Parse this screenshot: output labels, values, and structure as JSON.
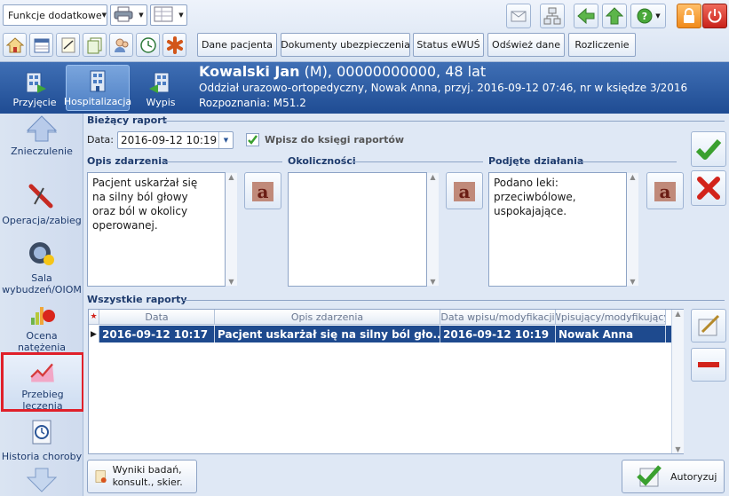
{
  "toolbar": {
    "functions_combo": "Funkcje dodatkowe",
    "nav_buttons": [
      "Dane pacjenta",
      "Dokumenty ubezpieczenia",
      "Status eWUŚ",
      "Odśwież dane",
      "Rozliczenie"
    ]
  },
  "header": {
    "modes": [
      "Przyjęcie",
      "Hospitalizacja",
      "Wypis"
    ],
    "patient_name": "Kowalski Jan",
    "patient_rest": " (M), 00000000000, 48 lat",
    "line2": "Oddział urazowo-ortopedyczny, Nowak Anna, przyj. 2016-09-12 07:46, nr w księdze 3/2016",
    "line3": "Rozpoznania: M51.2"
  },
  "sidebar": {
    "items": [
      {
        "label": "Znieczulenie"
      },
      {
        "label": "Operacja/zabieg"
      },
      {
        "label": "Sala wybudzeń/OIOM"
      },
      {
        "label": "Ocena natężenia bólu"
      },
      {
        "label": "Przebieg leczenia"
      },
      {
        "label": "Historia choroby"
      }
    ]
  },
  "current_report": {
    "title": "Bieżący raport",
    "date_label": "Data:",
    "date_value": "2016-09-12 10:19",
    "checkbox_label": "Wpisz do księgi raportów",
    "checkbox_checked": true,
    "fields": [
      {
        "label": "Opis zdarzenia",
        "value": "Pacjent uskarżał się na silny ból głowy oraz ból w okolicy operowanej."
      },
      {
        "label": "Okoliczności",
        "value": ""
      },
      {
        "label": "Podjęte działania",
        "value": "Podano leki: przeciwbólowe, uspokajające."
      }
    ]
  },
  "all_reports": {
    "title": "Wszystkie raporty",
    "columns": [
      "Data",
      "Opis zdarzenia",
      "Data wpisu/modyfikacji",
      "Wpisujący/modyfikujący"
    ],
    "rows": [
      {
        "date": "2016-09-12 10:17",
        "desc": "Pacjent uskarżał się na silny ból gło...",
        "mod_date": "2016-09-12 10:19",
        "author": "Nowak Anna"
      }
    ]
  },
  "footer": {
    "results_button": "Wyniki badań, konsult., skier.",
    "authorize_button": "Autoryzuj"
  },
  "colors": {
    "header_bg": "#1f4c93",
    "selected_row": "#1e4a8e",
    "highlight_outline": "#e0202a"
  }
}
